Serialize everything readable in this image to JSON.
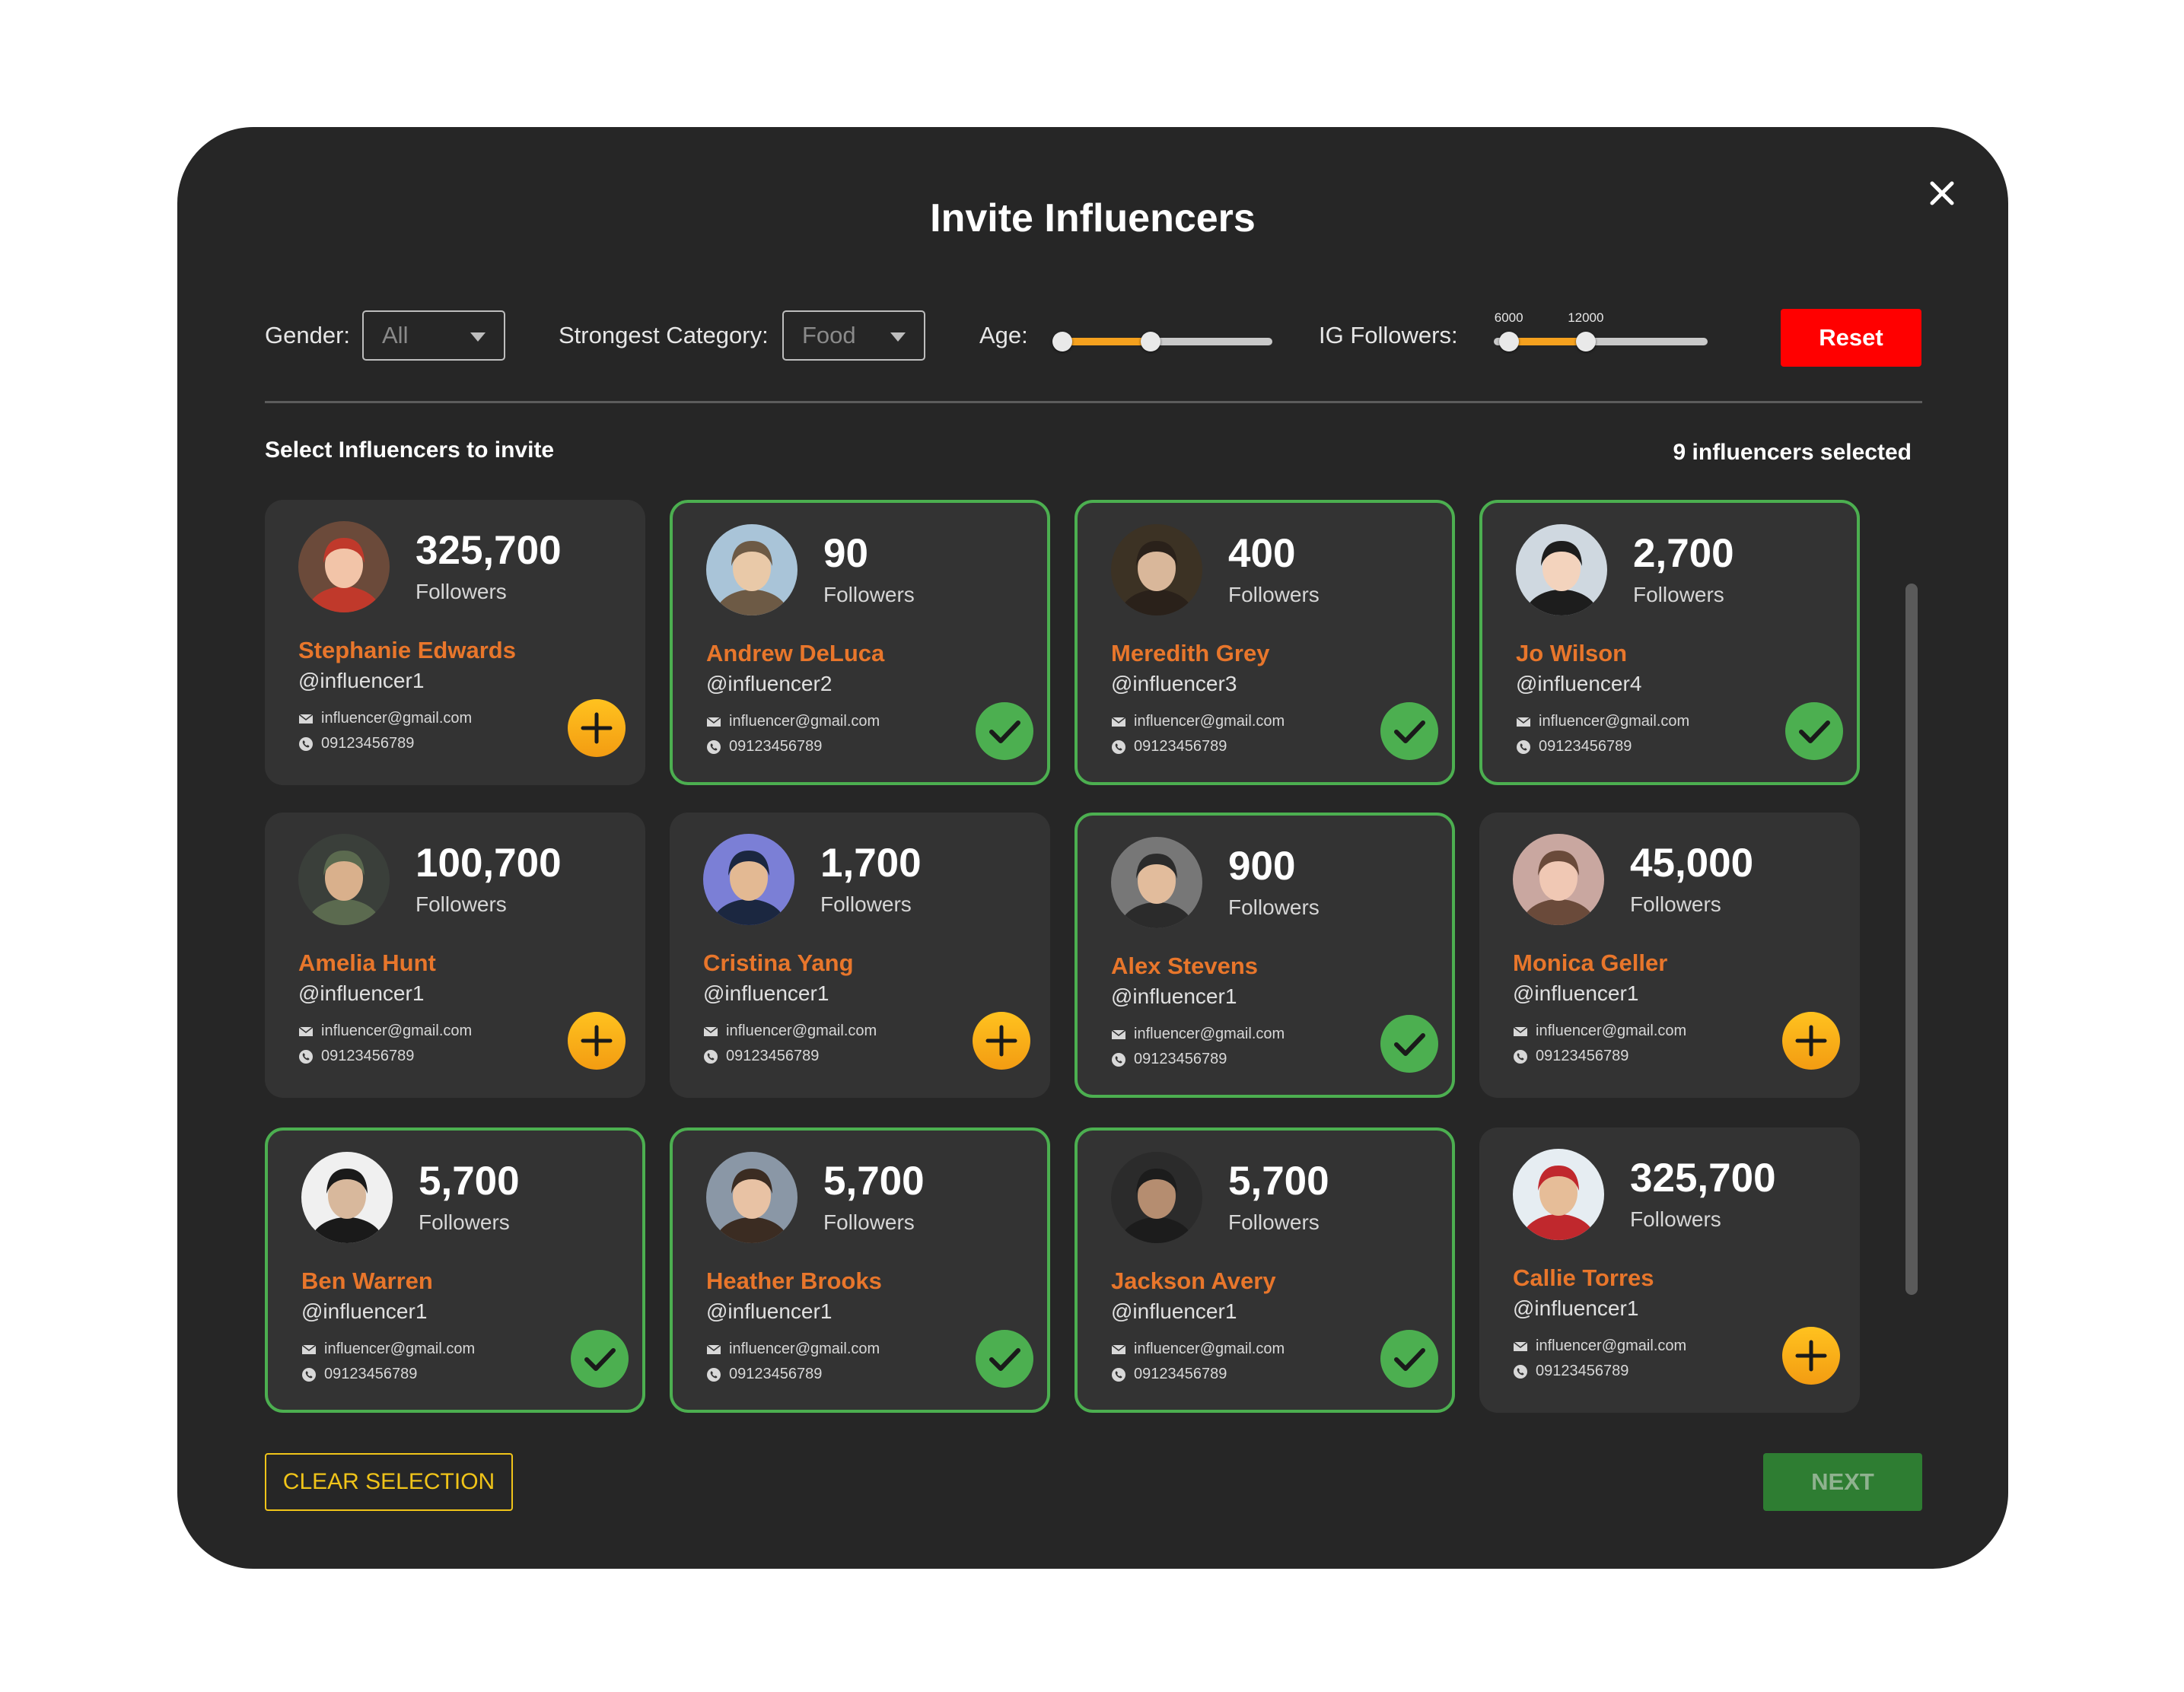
{
  "modal": {
    "title": "Invite Influencers",
    "close_icon": "close-icon"
  },
  "filters": {
    "gender": {
      "label": "Gender:",
      "value": "All"
    },
    "category": {
      "label": "Strongest Category:",
      "value": "Food"
    },
    "age": {
      "label": "Age:",
      "range_fraction": [
        0.0,
        0.42
      ]
    },
    "ig_followers": {
      "label": "IG Followers:",
      "min_label": "6000",
      "max_label": "12000",
      "range_fraction": [
        0.07,
        0.43
      ]
    },
    "reset_label": "Reset"
  },
  "section": {
    "title": "Select Influencers to invite",
    "selected_count": "9 influencers selected"
  },
  "influencers": [
    {
      "followers": "325,700",
      "followers_label": "Followers",
      "name": "Stephanie Edwards",
      "handle": "@influencer1",
      "email": "influencer@gmail.com",
      "phone": "09123456789",
      "selected": false
    },
    {
      "followers": "90",
      "followers_label": "Followers",
      "name": "Andrew DeLuca",
      "handle": "@influencer2",
      "email": "influencer@gmail.com",
      "phone": "09123456789",
      "selected": true
    },
    {
      "followers": "400",
      "followers_label": "Followers",
      "name": "Meredith Grey",
      "handle": "@influencer3",
      "email": "influencer@gmail.com",
      "phone": "09123456789",
      "selected": true
    },
    {
      "followers": "2,700",
      "followers_label": "Followers",
      "name": "Jo Wilson",
      "handle": "@influencer4",
      "email": "influencer@gmail.com",
      "phone": "09123456789",
      "selected": true
    },
    {
      "followers": "100,700",
      "followers_label": "Followers",
      "name": "Amelia Hunt",
      "handle": "@influencer1",
      "email": "influencer@gmail.com",
      "phone": "09123456789",
      "selected": false
    },
    {
      "followers": "1,700",
      "followers_label": "Followers",
      "name": "Cristina Yang",
      "handle": "@influencer1",
      "email": "influencer@gmail.com",
      "phone": "09123456789",
      "selected": false
    },
    {
      "followers": "900",
      "followers_label": "Followers",
      "name": "Alex Stevens",
      "handle": "@influencer1",
      "email": "influencer@gmail.com",
      "phone": "09123456789",
      "selected": true
    },
    {
      "followers": "45,000",
      "followers_label": "Followers",
      "name": "Monica Geller",
      "handle": "@influencer1",
      "email": "influencer@gmail.com",
      "phone": "09123456789",
      "selected": false
    },
    {
      "followers": "5,700",
      "followers_label": "Followers",
      "name": "Ben Warren",
      "handle": "@influencer1",
      "email": "influencer@gmail.com",
      "phone": "09123456789",
      "selected": true
    },
    {
      "followers": "5,700",
      "followers_label": "Followers",
      "name": "Heather Brooks",
      "handle": "@influencer1",
      "email": "influencer@gmail.com",
      "phone": "09123456789",
      "selected": true
    },
    {
      "followers": "5,700",
      "followers_label": "Followers",
      "name": "Jackson Avery",
      "handle": "@influencer1",
      "email": "influencer@gmail.com",
      "phone": "09123456789",
      "selected": true
    },
    {
      "followers": "325,700",
      "followers_label": "Followers",
      "name": "Callie Torres",
      "handle": "@influencer1",
      "email": "influencer@gmail.com",
      "phone": "09123456789",
      "selected": false
    }
  ],
  "footer": {
    "clear_label": "CLEAR SELECTION",
    "next_label": "NEXT"
  },
  "colors": {
    "selected_border": "#4caf50",
    "name": "#e8762b",
    "add_button": "#f5b41a",
    "check_button": "#4caf50",
    "reset": "#ff0000"
  }
}
